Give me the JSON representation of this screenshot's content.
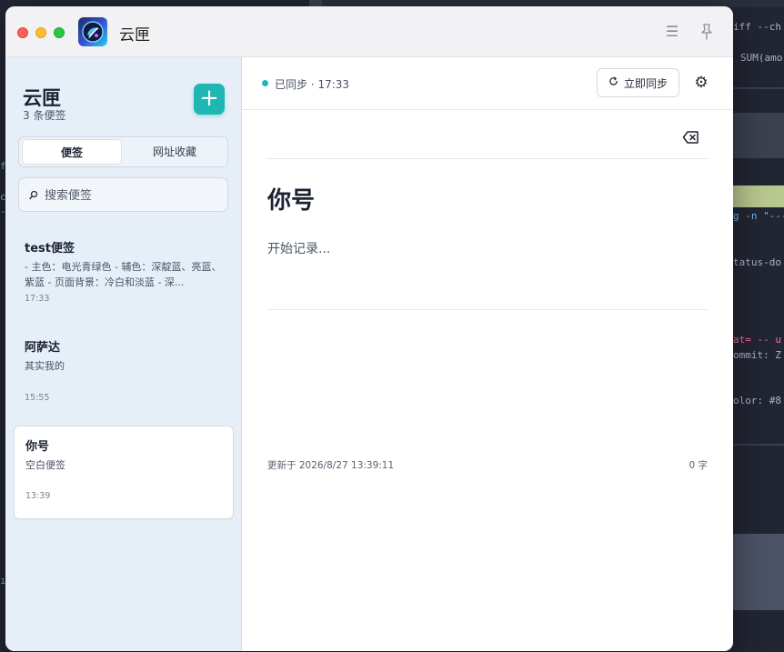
{
  "background": {
    "code_lines": [
      {
        "text": "iff --ch",
        "color": "#cfd4e0"
      },
      {
        "text": "SUM(amo",
        "color": "#cfd4e0"
      },
      {
        "text": "g -n \"---",
        "color": "#7fb3ff"
      },
      {
        "text": "tatus-do",
        "color": "#aeb4c4"
      },
      {
        "text": "at= -- u",
        "color": "#ff6b9a"
      },
      {
        "text": "ommit: Z",
        "color": "#aeb4c4"
      },
      {
        "text": "olor: #8",
        "color": "#aeb4c4"
      }
    ],
    "left_glyphs": [
      "f",
      "c",
      "-",
      "ı"
    ]
  },
  "window": {
    "app_title": "云匣",
    "menu_icon": "menu-icon",
    "pin_icon": "pin-icon"
  },
  "sidebar": {
    "title": "云匣",
    "count": "3 条便签",
    "add_label": "+",
    "tabs": [
      {
        "label": "便签",
        "active": true
      },
      {
        "label": "网址收藏",
        "active": false
      }
    ],
    "search": {
      "placeholder": "搜索便签",
      "value": ""
    },
    "notes": [
      {
        "title": "test便签",
        "preview": "- 主色：电光青绿色 - 辅色：深靛蓝、亮蓝、紫蓝 - 页面背景：冷白和淡蓝 - 深...",
        "time": "17:33",
        "active": false
      },
      {
        "title": "阿萨达",
        "preview": "其实我的",
        "time": "15:55",
        "active": false
      },
      {
        "title": "你号",
        "preview": "空白便签",
        "time": "13:39",
        "active": true
      }
    ]
  },
  "main": {
    "sync_status": "已同步 · 17:33",
    "sync_button": "立即同步",
    "note_title": "你号",
    "note_body_placeholder": "开始记录...",
    "updated": "更新于 2026/8/27 13:39:11",
    "word_count": "0 字"
  },
  "colors": {
    "accent": "#1eb7b3",
    "sidebar_bg": "#e6eef8",
    "text_primary": "#1c2233"
  }
}
